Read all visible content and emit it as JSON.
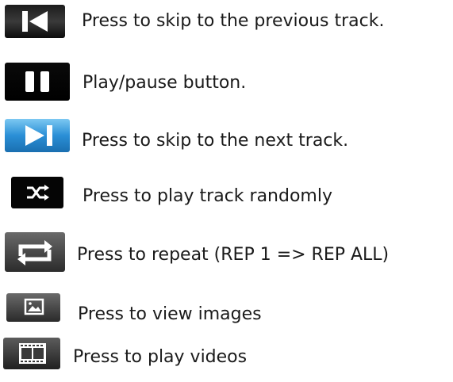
{
  "legend": {
    "items": [
      {
        "icon": "skip-previous-icon",
        "label": "Press to skip to the previous track."
      },
      {
        "icon": "play-pause-icon",
        "label": "Play/pause button."
      },
      {
        "icon": "skip-next-icon",
        "label": "Press to skip to the next track."
      },
      {
        "icon": "shuffle-icon",
        "label": "Press to play track randomly"
      },
      {
        "icon": "repeat-icon",
        "label": "Press to repeat (REP 1 => REP ALL)"
      },
      {
        "icon": "image-icon",
        "label": "Press to view images"
      },
      {
        "icon": "video-icon",
        "label": "Press to play videos"
      }
    ]
  },
  "colors": {
    "button_dark": "#111111",
    "button_gray": "#5a5a5a",
    "button_blue": "#2a8fd6",
    "glyph_white": "#ffffff",
    "text": "#1a1a1a"
  }
}
